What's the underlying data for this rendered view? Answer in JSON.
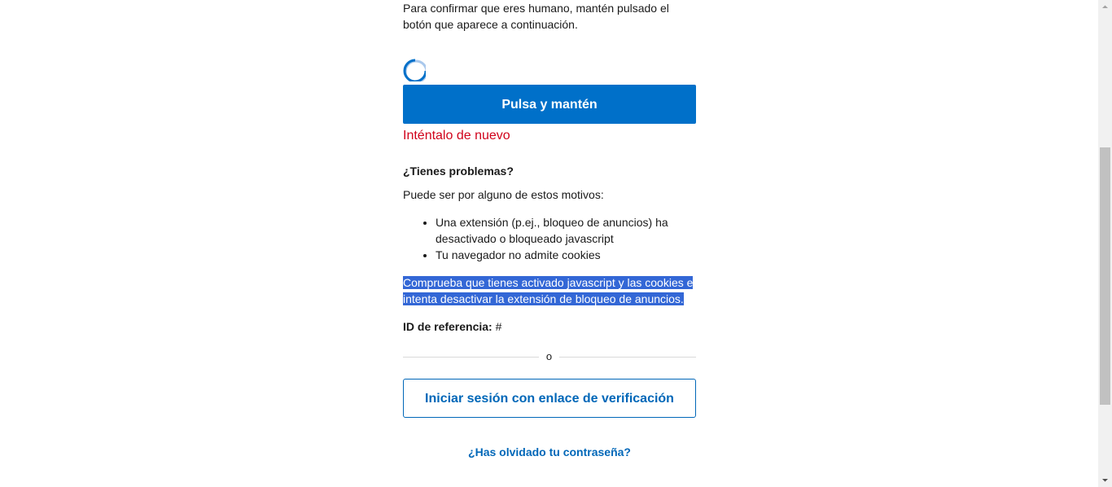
{
  "challenge": {
    "intro_text": "Para confirmar que eres humano, mantén pulsado el botón que aparece a continuación.",
    "hold_button_label": "Pulsa y mantén",
    "error_text": "Inténtalo de nuevo"
  },
  "help": {
    "title": "¿Tienes problemas?",
    "reasons_intro": "Puede ser por alguno de estos motivos:",
    "reasons": [
      "Una extensión (p.ej., bloqueo de anuncios) ha desactivado o bloqueado javascript",
      "Tu navegador no admite cookies"
    ],
    "advice_text": "Comprueba que tienes activado javascript y las cookies e intenta desactivar la extensión de bloqueo de anuncios.",
    "reference_label": "ID de referencia:",
    "reference_value": "#"
  },
  "alternatives": {
    "divider_text": "o",
    "verify_link_button_label": "Iniciar sesión con enlace de verificación",
    "forgot_password_label": "¿Has olvidado tu contraseña?"
  },
  "colors": {
    "primary": "#0070c9",
    "link": "#0067b8",
    "error": "#d0021b",
    "selection": "#3367d6"
  },
  "icons": {
    "spinner": "loading-spinner-icon",
    "scroll_up": "arrow-up-icon",
    "scroll_down": "arrow-down-icon"
  }
}
